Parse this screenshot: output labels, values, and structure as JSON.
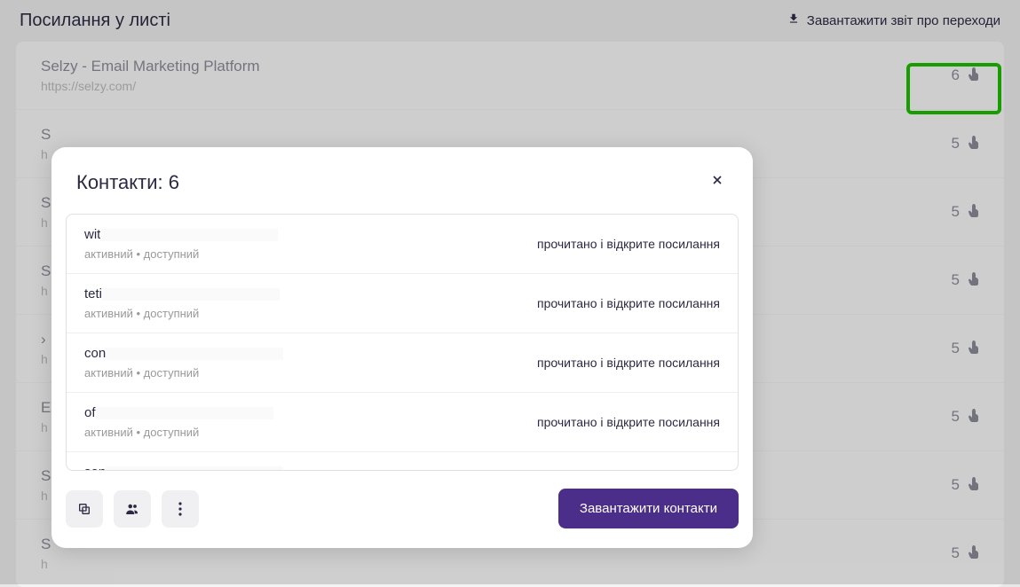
{
  "header": {
    "title": "Посилання у листі",
    "download_report": "Завантажити звіт про переходи"
  },
  "links": [
    {
      "title": "Selzy - Email Marketing Platform",
      "url": "https://selzy.com/",
      "clicks": 6
    },
    {
      "title": "S",
      "url": "h",
      "clicks": 5
    },
    {
      "title": "S",
      "url": "h",
      "clicks": 5
    },
    {
      "title": "S",
      "url": "h",
      "clicks": 5
    },
    {
      "title": "›",
      "url": "h",
      "clicks": 5
    },
    {
      "title": "E",
      "url": "h",
      "clicks": 5
    },
    {
      "title": "S",
      "url": "h",
      "clicks": 5
    },
    {
      "title": "S",
      "url": "h",
      "clicks": 5
    }
  ],
  "modal": {
    "title": "Контакти: 6",
    "download_button": "Завантажити контакти",
    "status_text": "активний  •  доступний",
    "action_text": "прочитано і відкрите посилання",
    "contacts": [
      {
        "email_prefix": "wit"
      },
      {
        "email_prefix": "teti"
      },
      {
        "email_prefix": "con"
      },
      {
        "email_prefix": "of"
      },
      {
        "email_prefix": "sen"
      }
    ]
  }
}
